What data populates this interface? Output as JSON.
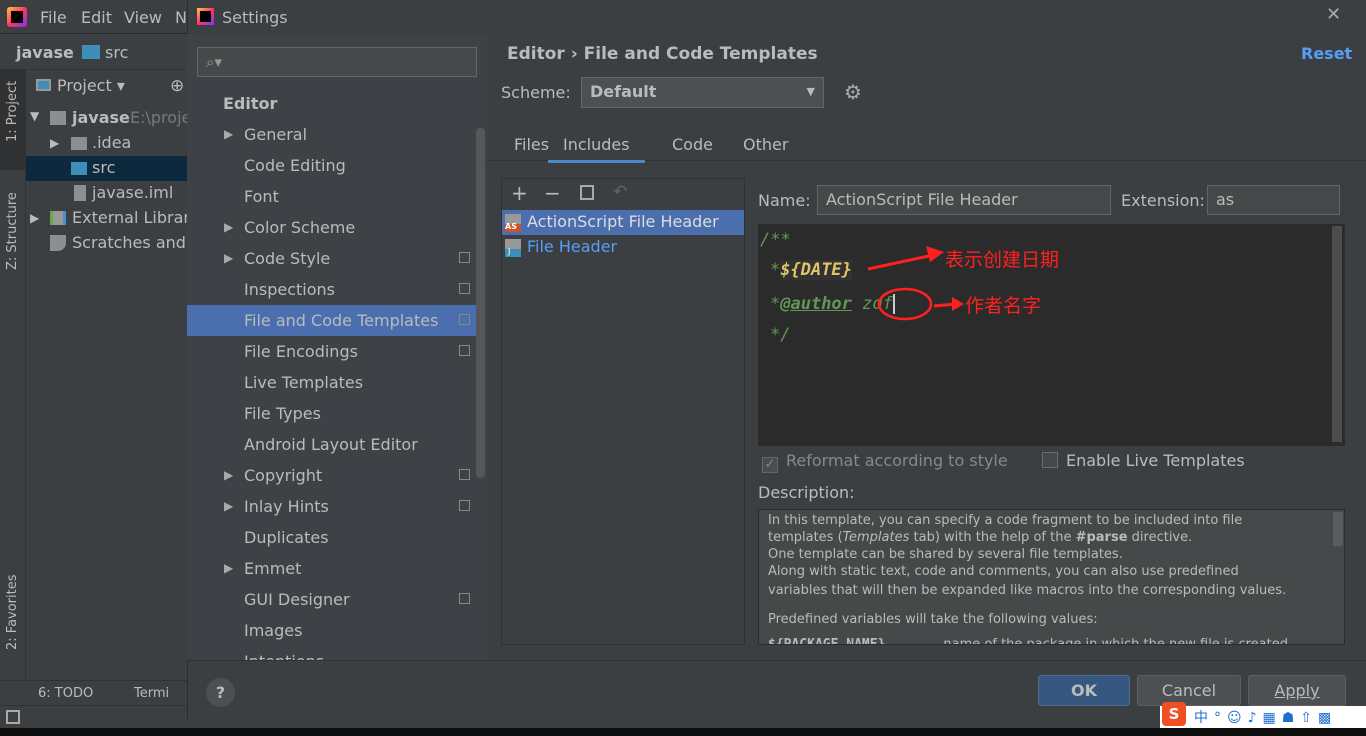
{
  "ide": {
    "menu": [
      "File",
      "Edit",
      "View",
      "N"
    ],
    "breadcrumb": [
      "javase",
      "src"
    ],
    "left_tabs": [
      "1: Project",
      "Z: Structure",
      "2: Favorites"
    ],
    "project_header": "Project",
    "tree": [
      {
        "label": "javase",
        "extra": "E:\\proje"
      },
      {
        "label": ".idea"
      },
      {
        "label": "src"
      },
      {
        "label": "javase.iml"
      },
      {
        "label": "External Librari"
      },
      {
        "label": "Scratches and C"
      }
    ],
    "bottom_tabs": [
      "6: TODO",
      "Termi"
    ]
  },
  "dialog": {
    "title": "Settings",
    "search_placeholder": "",
    "tree_header": "Editor",
    "tree_items": [
      {
        "label": "General",
        "arrow": true
      },
      {
        "label": "Code Editing"
      },
      {
        "label": "Font"
      },
      {
        "label": "Color Scheme",
        "arrow": true
      },
      {
        "label": "Code Style",
        "arrow": true,
        "copy": true
      },
      {
        "label": "Inspections",
        "copy": true
      },
      {
        "label": "File and Code Templates",
        "copy": true,
        "selected": true
      },
      {
        "label": "File Encodings",
        "copy": true
      },
      {
        "label": "Live Templates"
      },
      {
        "label": "File Types"
      },
      {
        "label": "Android Layout Editor"
      },
      {
        "label": "Copyright",
        "arrow": true,
        "copy": true
      },
      {
        "label": "Inlay Hints",
        "arrow": true,
        "copy": true
      },
      {
        "label": "Duplicates"
      },
      {
        "label": "Emmet",
        "arrow": true
      },
      {
        "label": "GUI Designer",
        "copy": true
      },
      {
        "label": "Images"
      },
      {
        "label": "Intentions"
      }
    ],
    "breadcrumb": [
      "Editor",
      "File and Code Templates"
    ],
    "reset": "Reset",
    "scheme_label": "Scheme:",
    "scheme_value": "Default",
    "tabs": [
      "Files",
      "Includes",
      "Code",
      "Other"
    ],
    "active_tab": "Includes",
    "templates": [
      {
        "label": "ActionScript File Header",
        "badge": "AS",
        "selected": true
      },
      {
        "label": "File Header",
        "badge": "J"
      }
    ],
    "name_label": "Name:",
    "name_value": "ActionScript File Header",
    "ext_label": "Extension:",
    "ext_value": "as",
    "code": {
      "l1": "/**",
      "l2_star": "*",
      "l2_var": "${DATE}",
      "l3_star": "*",
      "l3_tag": "@author",
      "l3_val": "zdf",
      "l4": "*/"
    },
    "annotations": {
      "date": "表示创建日期",
      "author": "作者名字"
    },
    "reformat_label": "Reformat according to style",
    "reformat_checked": true,
    "live_label": "Enable Live Templates",
    "live_checked": false,
    "description_label": "Description:",
    "description": {
      "p1a": "In this template, you can specify a code fragment to be included into file",
      "p1b_pre": "templates (",
      "p1b_it": "Templates",
      "p1b_mid": " tab) with the help of the ",
      "p1b_b": "#parse",
      "p1b_post": " directive.",
      "p2": "One template can be shared by several file templates.",
      "p3": "Along with static text, code and comments, you can also use predefined",
      "p4": "variables that will then be expanded like macros into the corresponding values.",
      "p5": "Predefined variables will take the following values:",
      "p6a": "${PACKAGE_NAME}",
      "p6b": "name of the package in which the new file is created"
    },
    "buttons": {
      "ok": "OK",
      "cancel": "Cancel",
      "apply": "Apply",
      "help": "?"
    }
  },
  "colors": {
    "accent": "#4b6eaf",
    "link": "#589df6",
    "annotation": "#ff2020",
    "comment": "#629755"
  }
}
